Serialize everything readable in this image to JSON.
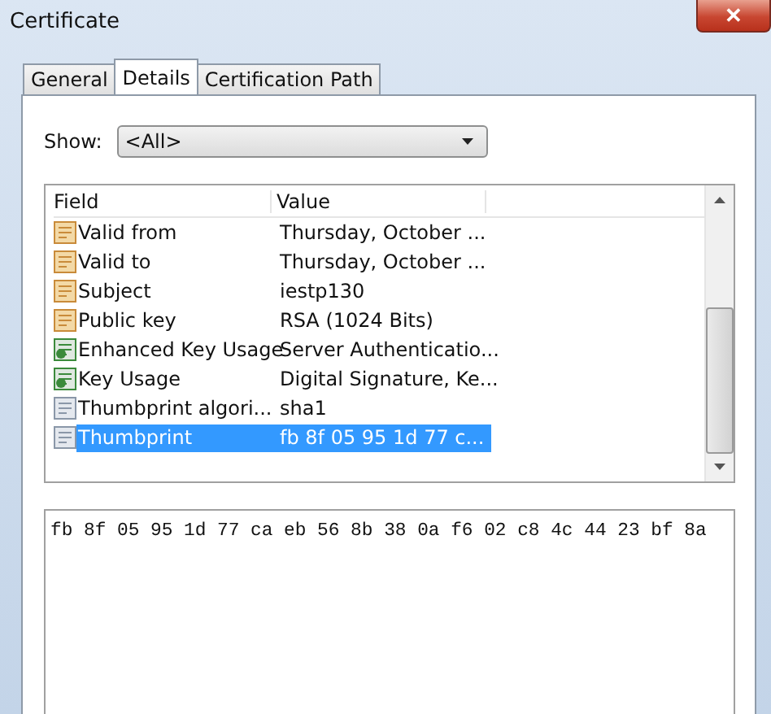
{
  "window": {
    "title": "Certificate",
    "close": "✕"
  },
  "tabs": [
    {
      "label": "General",
      "selected": false
    },
    {
      "label": "Details",
      "selected": true
    },
    {
      "label": "Certification Path",
      "selected": false
    }
  ],
  "show": {
    "label": "Show:",
    "value": "<All>"
  },
  "table": {
    "columns": [
      "Field",
      "Value"
    ],
    "rows": [
      {
        "kind": "property",
        "field": "Valid from",
        "value": "Thursday, October ...",
        "selected": false
      },
      {
        "kind": "property",
        "field": "Valid to",
        "value": "Thursday, October ...",
        "selected": false
      },
      {
        "kind": "property",
        "field": "Subject",
        "value": "iestp130",
        "selected": false
      },
      {
        "kind": "property",
        "field": "Public key",
        "value": "RSA (1024 Bits)",
        "selected": false
      },
      {
        "kind": "extension",
        "field": "Enhanced Key Usage",
        "value": "Server Authenticatio...",
        "selected": false
      },
      {
        "kind": "extension",
        "field": "Key Usage",
        "value": "Digital Signature, Ke...",
        "selected": false
      },
      {
        "kind": "plain",
        "field": "Thumbprint algori...",
        "value": "sha1",
        "selected": false
      },
      {
        "kind": "plain",
        "field": "Thumbprint",
        "value": "fb 8f 05 95 1d 77 c...",
        "selected": true
      }
    ]
  },
  "detail": {
    "value": "fb 8f 05 95 1d 77 ca eb 56 8b 38 0a f6 02 c8 4c 44 23 bf 8a"
  }
}
